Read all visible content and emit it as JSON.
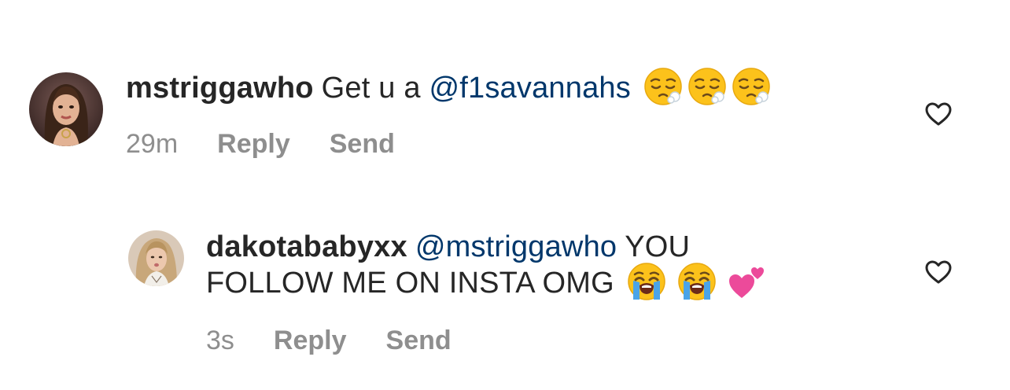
{
  "comments": [
    {
      "username": "mstriggawho",
      "text_before": "Get u a",
      "mention": "@f1savannahs",
      "text_after": "",
      "emojis": [
        "sleepy-face",
        "sleepy-face",
        "sleepy-face"
      ],
      "time": "29m",
      "reply_label": "Reply",
      "send_label": "Send"
    },
    {
      "username": "dakotababyxx",
      "mention": "@mstriggawho",
      "text_after": "YOU FOLLOW ME ON INSTA OMG",
      "emojis": [
        "loudly-crying-face",
        "loudly-crying-face",
        "two-hearts"
      ],
      "time": "3s",
      "reply_label": "Reply",
      "send_label": "Send"
    }
  ],
  "colors": {
    "text": "#262626",
    "mention": "#00376b",
    "meta": "#8e8e8e",
    "heart_outline": "#262626"
  },
  "icons": {
    "like": "heart-outline-icon"
  }
}
